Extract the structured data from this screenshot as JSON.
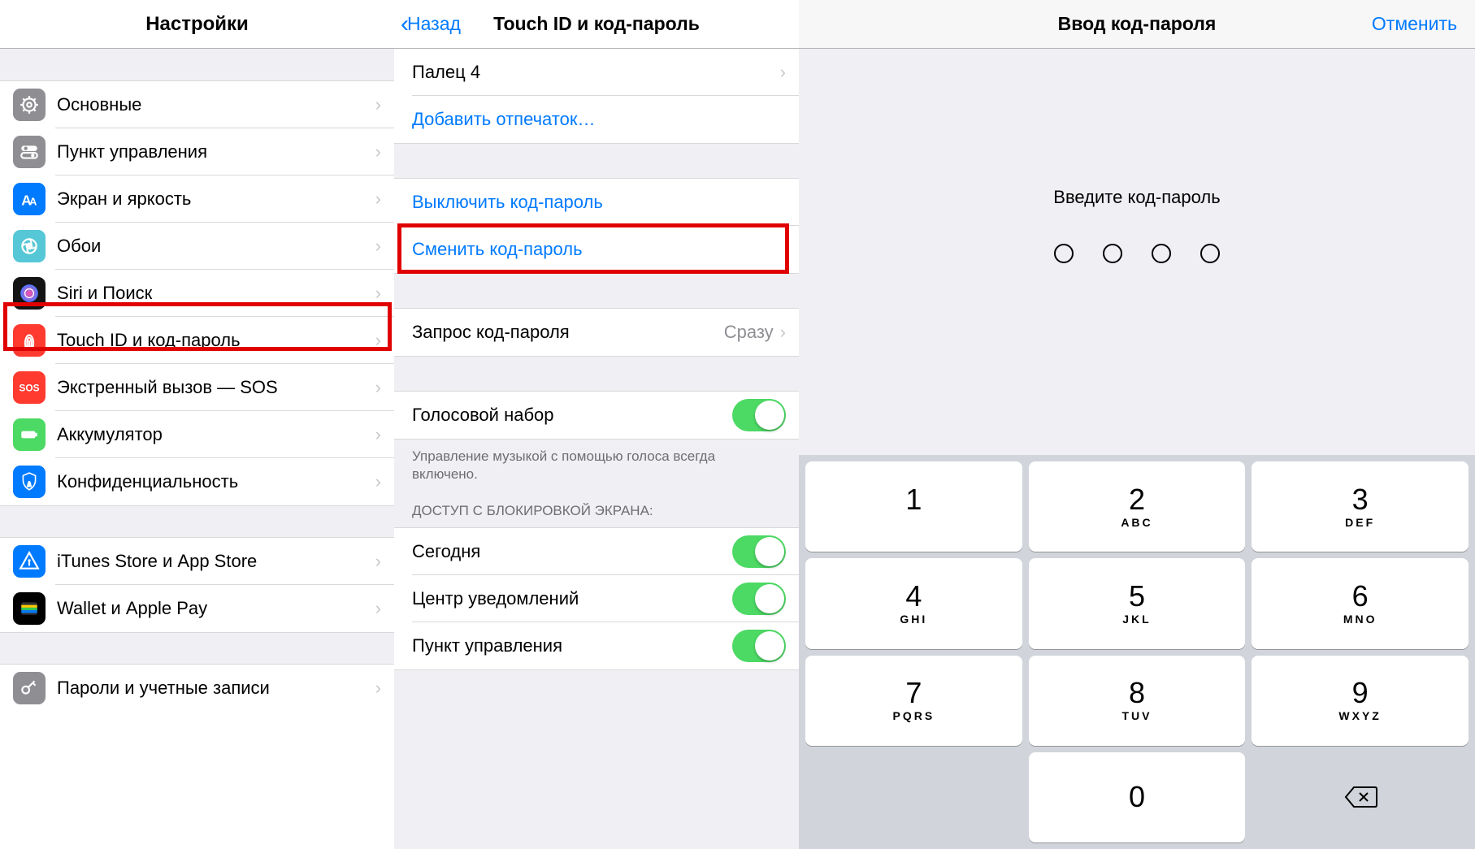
{
  "panel1": {
    "title": "Настройки",
    "groups": [
      [
        {
          "id": "general",
          "label": "Основные",
          "iconClass": "ic-gray"
        },
        {
          "id": "control",
          "label": "Пункт управления",
          "iconClass": "ic-gray2"
        },
        {
          "id": "display",
          "label": "Экран и яркость",
          "iconClass": "ic-blue"
        },
        {
          "id": "wallpaper",
          "label": "Обои",
          "iconClass": "ic-teal"
        },
        {
          "id": "siri",
          "label": "Siri и Поиск",
          "iconClass": "ic-black"
        },
        {
          "id": "touchid",
          "label": "Touch ID и код-пароль",
          "iconClass": "ic-red"
        },
        {
          "id": "sos",
          "label": "Экстренный вызов — SOS",
          "iconClass": "ic-red2"
        },
        {
          "id": "battery",
          "label": "Аккумулятор",
          "iconClass": "ic-green"
        },
        {
          "id": "privacy",
          "label": "Конфиденциальность",
          "iconClass": "ic-blue2"
        }
      ],
      [
        {
          "id": "itunes",
          "label": "iTunes Store и App Store",
          "iconClass": "ic-blue3"
        },
        {
          "id": "wallet",
          "label": "Wallet и Apple Pay",
          "iconClass": "ic-wallet"
        }
      ],
      [
        {
          "id": "passwords",
          "label": "Пароли и учетные записи",
          "iconClass": "ic-gray3"
        }
      ]
    ]
  },
  "panel2": {
    "back": "Назад",
    "title": "Touch ID и код-пароль",
    "finger": "Палец 4",
    "add_fingerprint": "Добавить отпечаток…",
    "turn_off": "Выключить код-пароль",
    "change": "Сменить код-пароль",
    "require": {
      "label": "Запрос код-пароля",
      "value": "Сразу"
    },
    "voice_dial": "Голосовой набор",
    "voice_dial_footer": "Управление музыкой с помощью голоса всегда включено.",
    "lock_header": "ДОСТУП С БЛОКИРОВКОЙ ЭКРАНА:",
    "lock_items": [
      {
        "label": "Сегодня"
      },
      {
        "label": "Центр уведомлений"
      },
      {
        "label": "Пункт управления"
      }
    ]
  },
  "panel3": {
    "title": "Ввод код-пароля",
    "cancel": "Отменить",
    "prompt": "Введите код-пароль",
    "keypad": [
      {
        "digit": "1",
        "letters": ""
      },
      {
        "digit": "2",
        "letters": "ABC"
      },
      {
        "digit": "3",
        "letters": "DEF"
      },
      {
        "digit": "4",
        "letters": "GHI"
      },
      {
        "digit": "5",
        "letters": "JKL"
      },
      {
        "digit": "6",
        "letters": "MNO"
      },
      {
        "digit": "7",
        "letters": "PQRS"
      },
      {
        "digit": "8",
        "letters": "TUV"
      },
      {
        "digit": "9",
        "letters": "WXYZ"
      },
      {
        "digit": "0",
        "letters": ""
      }
    ]
  }
}
